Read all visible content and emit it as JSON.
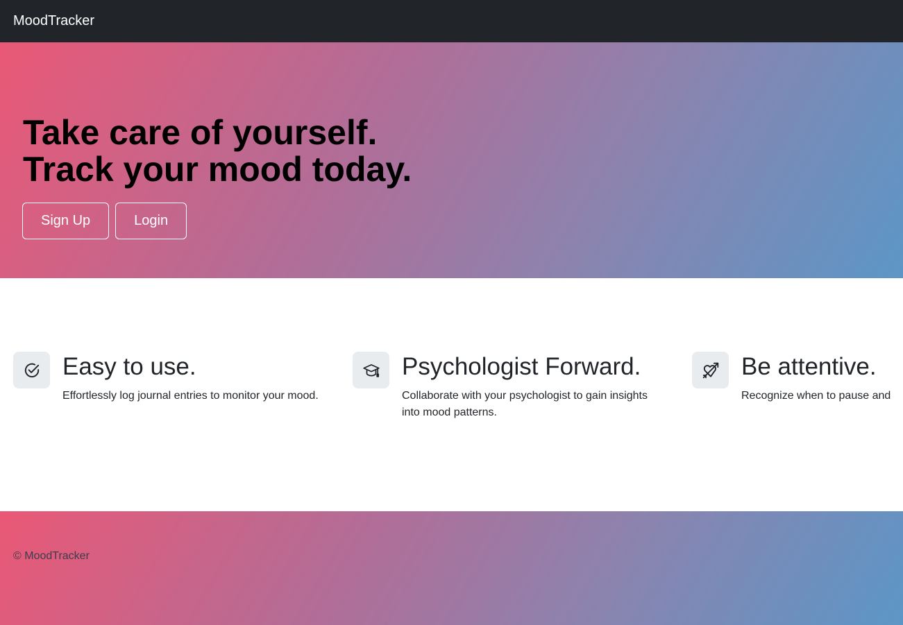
{
  "navbar": {
    "brand": "MoodTracker"
  },
  "hero": {
    "title_line1": "Take care of yourself.",
    "title_line2": "Track your mood today.",
    "signup_label": "Sign Up",
    "login_label": "Login"
  },
  "features": [
    {
      "icon": "check-circle-icon",
      "title": "Easy to use.",
      "text": "Effortlessly log journal entries to monitor your mood."
    },
    {
      "icon": "graduation-cap-icon",
      "title": "Psychologist Forward.",
      "text": "Collaborate with your psychologist to gain insights into mood patterns."
    },
    {
      "icon": "heart-arrow-icon",
      "title": "Be attentive.",
      "text": "Recognize when to pause and"
    }
  ],
  "footer": {
    "copyright": "© MoodTracker"
  },
  "colors": {
    "navbar_bg": "#212529",
    "gradient_start": "#ea5876",
    "gradient_end": "#5c96c6",
    "icon_bg": "#e9ecef"
  }
}
